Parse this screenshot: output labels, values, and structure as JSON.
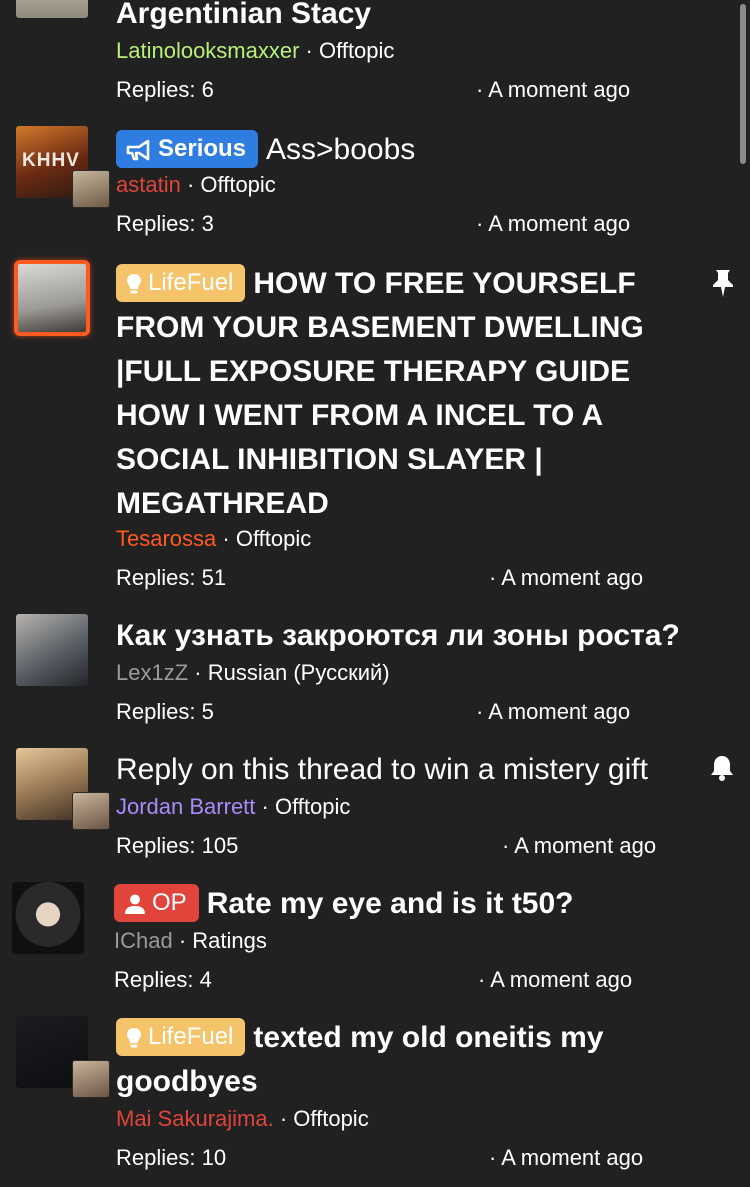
{
  "threads": [
    {
      "title": "Argentinian Stacy",
      "author": "Latinolooksmaxxer",
      "author_color": "#b7f07a",
      "category": "Offtopic",
      "replies": "Replies: 6",
      "time": "A moment ago"
    },
    {
      "badge": "Serious",
      "title": "Ass>boobs",
      "author": "astatin",
      "author_color": "#e0443a",
      "category": "Offtopic",
      "replies": "Replies: 3",
      "time": "A moment ago",
      "avatar_text": "KHHV"
    },
    {
      "badge": "LifeFuel",
      "title": "HOW TO FREE YOURSELF FROM YOUR BASEMENT DWELLING |FULL EXPOSURE THERAPY GUIDE HOW I WENT FROM A INCEL TO A SOCIAL INHIBITION SLAYER | MEGATHREAD",
      "author": "Tesarossa",
      "author_color": "#ff5a1f",
      "category": "Offtopic",
      "replies": "Replies: 51",
      "time": "A moment ago",
      "icon": "pin-icon"
    },
    {
      "title": "Как узнать закроются ли зоны роста?",
      "author": "Lex1zZ",
      "author_color": "#9a9a9a",
      "category": "Russian (Русский)",
      "replies": "Replies: 5",
      "time": "A moment ago"
    },
    {
      "title": "Reply on this thread to win a mistery gift",
      "author": "Jordan Barrett",
      "author_color": "#a78bfa",
      "category": "Offtopic",
      "replies": "Replies: 105",
      "time": "A moment ago",
      "icon": "bell-icon"
    },
    {
      "badge": "OP",
      "title": "Rate my eye and is it t50?",
      "author": "IChad",
      "author_color": "#9a9a9a",
      "category": "Ratings",
      "replies": "Replies: 4",
      "time": "A moment ago"
    },
    {
      "badge": "LifeFuel",
      "title": "texted my old oneitis my goodbyes",
      "author": "Mai Sakurajima.",
      "author_color": "#e0443a",
      "category": "Offtopic",
      "replies": "Replies: 10",
      "time": "A moment ago"
    }
  ],
  "separator": " · ",
  "time_prefix": "· "
}
